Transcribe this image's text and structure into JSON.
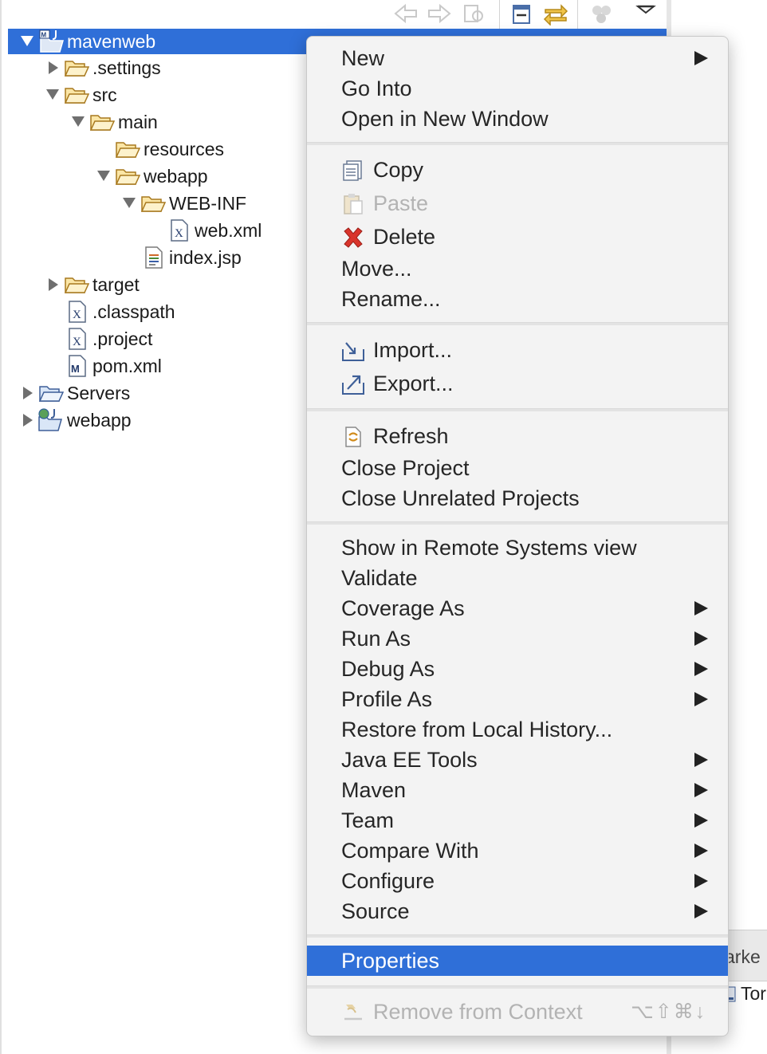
{
  "tree": [
    {
      "label": "mavenweb",
      "selected": true
    },
    {
      "label": ".settings"
    },
    {
      "label": "src"
    },
    {
      "label": "main"
    },
    {
      "label": "resources"
    },
    {
      "label": "webapp"
    },
    {
      "label": "WEB-INF"
    },
    {
      "label": "web.xml"
    },
    {
      "label": "index.jsp"
    },
    {
      "label": "target"
    },
    {
      "label": ".classpath"
    },
    {
      "label": ".project"
    },
    {
      "label": "pom.xml"
    },
    {
      "label": "Servers"
    },
    {
      "label": "webapp"
    }
  ],
  "menu": {
    "new": "New",
    "go_into": "Go Into",
    "open_new_window": "Open in New Window",
    "copy": "Copy",
    "paste": "Paste",
    "delete": "Delete",
    "move": "Move...",
    "rename": "Rename...",
    "import": "Import...",
    "export": "Export...",
    "refresh": "Refresh",
    "close_project": "Close Project",
    "close_unrelated": "Close Unrelated Projects",
    "show_remote": "Show in Remote Systems view",
    "validate": "Validate",
    "coverage_as": "Coverage As",
    "run_as": "Run As",
    "debug_as": "Debug As",
    "profile_as": "Profile As",
    "restore_history": "Restore from Local History...",
    "java_ee_tools": "Java EE Tools",
    "maven": "Maven",
    "team": "Team",
    "compare_with": "Compare With",
    "configure": "Configure",
    "source": "Source",
    "properties": "Properties",
    "remove_context": "Remove from Context",
    "remove_context_shortcut": "⌥⇧⌘↓"
  },
  "side_panel": {
    "markers_tab": "arke",
    "server_item": "Tor"
  },
  "colors": {
    "selection": "#2f6fd8",
    "menu_bg": "#f3f3f3",
    "delete_red": "#d9342b",
    "folder": "#c8962a"
  }
}
